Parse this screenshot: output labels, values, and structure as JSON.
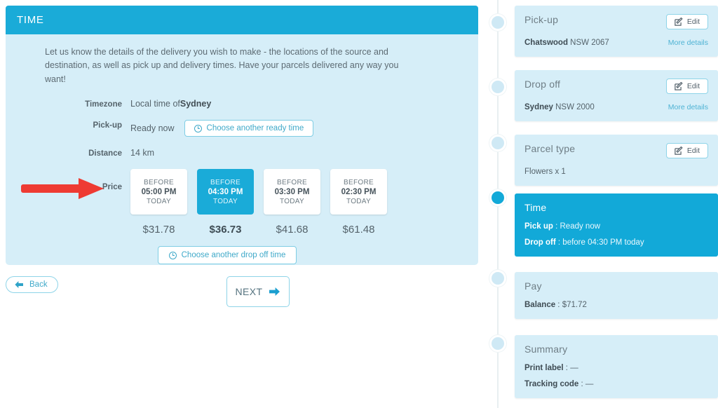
{
  "panel": {
    "title": "TIME",
    "intro": "Let us know the details of the delivery you wish to make - the locations of the source and destination, as well as pick up and delivery times. Have your parcels delivered any way you want!",
    "rows": {
      "timezone_label": "Timezone",
      "timezone_value_prefix": "Local time of ",
      "timezone_city": "Sydney",
      "pickup_label": "Pick-up",
      "pickup_value": "Ready now",
      "pickup_button": "Choose another ready time",
      "distance_label": "Distance",
      "distance_value": "14 km",
      "price_label": "Price",
      "dropoff_button": "Choose another drop off time"
    },
    "price_cards": [
      {
        "before": "BEFORE",
        "time": "05:00 PM",
        "day": "TODAY",
        "price": "$31.78",
        "selected": false
      },
      {
        "before": "BEFORE",
        "time": "04:30 PM",
        "day": "TODAY",
        "price": "$36.73",
        "selected": true
      },
      {
        "before": "BEFORE",
        "time": "03:30 PM",
        "day": "TODAY",
        "price": "$41.68",
        "selected": false
      },
      {
        "before": "BEFORE",
        "time": "02:30 PM",
        "day": "TODAY",
        "price": "$61.48",
        "selected": false
      }
    ]
  },
  "nav": {
    "back_label": "Back",
    "next_label": "NEXT"
  },
  "annotation": {
    "arrow_color": "#ee3b33"
  },
  "timeline": {
    "edit_label": "Edit",
    "more_label": "More details",
    "items": [
      {
        "title": "Pick-up",
        "line1_bold": "Chatswood",
        "line1_rest": " NSW 2067",
        "has_edit": true,
        "has_more": true,
        "active": false
      },
      {
        "title": "Drop off",
        "line1_bold": "Sydney",
        "line1_rest": " NSW 2000",
        "has_edit": true,
        "has_more": true,
        "active": false
      },
      {
        "title": "Parcel type",
        "line1_bold": "",
        "line1_rest": "Flowers x 1",
        "has_edit": true,
        "has_more": false,
        "active": false
      },
      {
        "title": "Time",
        "line1_bold": "Pick up",
        "line1_rest": " : Ready now",
        "line2_bold": "Drop off",
        "line2_rest": " : before 04:30 PM today",
        "has_edit": false,
        "has_more": false,
        "active": true
      },
      {
        "title": "Pay",
        "line1_bold": "Balance",
        "line1_rest": " : $71.72",
        "has_edit": false,
        "has_more": false,
        "active": false
      },
      {
        "title": "Summary",
        "line1_bold": "Print label",
        "line1_rest": " : —",
        "line2_bold": "Tracking code",
        "line2_rest": " : —",
        "has_edit": false,
        "has_more": false,
        "active": false
      }
    ]
  },
  "colors": {
    "accent": "#1aabd8",
    "panel_bg": "#d6eef8",
    "link": "#4fb3d4"
  }
}
